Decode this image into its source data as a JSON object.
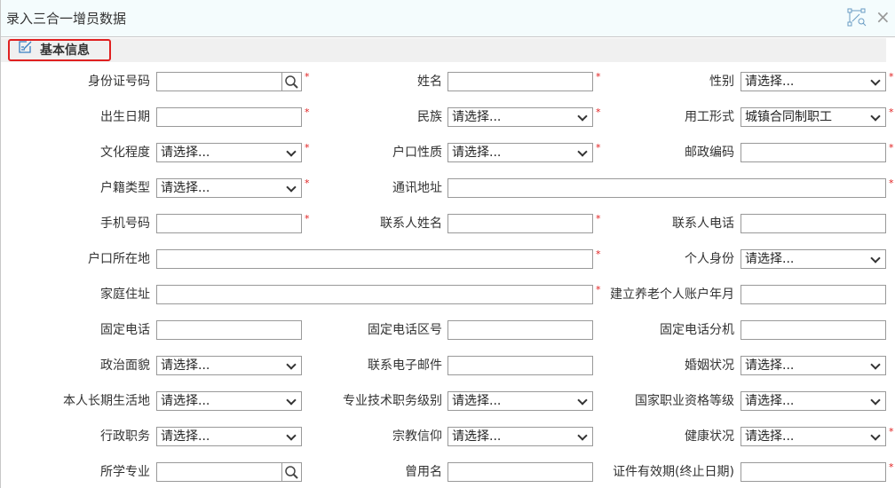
{
  "window": {
    "title": "录入三合一增员数据",
    "close": "×"
  },
  "section": {
    "title": "基本信息"
  },
  "rows": [
    [
      {
        "label": "身份证号码",
        "type": "search",
        "value": "",
        "req": true
      },
      {
        "label": "姓名",
        "type": "text",
        "value": "",
        "req": true
      },
      {
        "label": "性别",
        "type": "select",
        "value": "请选择...",
        "req": true
      }
    ],
    [
      {
        "label": "出生日期",
        "type": "text",
        "value": "",
        "req": true
      },
      {
        "label": "民族",
        "type": "select",
        "value": "请选择...",
        "req": true
      },
      {
        "label": "用工形式",
        "type": "select",
        "value": "城镇合同制职工",
        "req": true
      }
    ],
    [
      {
        "label": "文化程度",
        "type": "select",
        "value": "请选择...",
        "req": true
      },
      {
        "label": "户口性质",
        "type": "select",
        "value": "请选择...",
        "req": true
      },
      {
        "label": "邮政编码",
        "type": "text",
        "value": "",
        "req": true
      }
    ],
    [
      {
        "label": "户籍类型",
        "type": "select",
        "value": "请选择...",
        "req": true
      },
      {
        "label": "通讯地址",
        "type": "text",
        "value": "",
        "req": true,
        "span": 2
      }
    ],
    [
      {
        "label": "手机号码",
        "type": "text",
        "value": "",
        "req": true
      },
      {
        "label": "联系人姓名",
        "type": "text",
        "value": "",
        "req": true
      },
      {
        "label": "联系人电话",
        "type": "text",
        "value": "",
        "req": false
      }
    ],
    [
      {
        "label": "户口所在地",
        "type": "text",
        "value": "",
        "req": true,
        "span": 2
      },
      {
        "label": "个人身份",
        "type": "select",
        "value": "请选择...",
        "req": false
      }
    ],
    [
      {
        "label": "家庭住址",
        "type": "text",
        "value": "",
        "req": true,
        "span": 2
      },
      {
        "label": "建立养老个人账户年月",
        "type": "text",
        "value": "",
        "req": false
      }
    ],
    [
      {
        "label": "固定电话",
        "type": "text",
        "value": "",
        "req": false
      },
      {
        "label": "固定电话区号",
        "type": "text",
        "value": "",
        "req": false
      },
      {
        "label": "固定电话分机",
        "type": "text",
        "value": "",
        "req": false
      }
    ],
    [
      {
        "label": "政治面貌",
        "type": "select",
        "value": "请选择...",
        "req": false
      },
      {
        "label": "联系电子邮件",
        "type": "text",
        "value": "",
        "req": false
      },
      {
        "label": "婚姻状况",
        "type": "select",
        "value": "请选择...",
        "req": false
      }
    ],
    [
      {
        "label": "本人长期生活地",
        "type": "select",
        "value": "请选择...",
        "req": false
      },
      {
        "label": "专业技术职务级别",
        "type": "select",
        "value": "请选择...",
        "req": false
      },
      {
        "label": "国家职业资格等级",
        "type": "select",
        "value": "请选择...",
        "req": false
      }
    ],
    [
      {
        "label": "行政职务",
        "type": "select",
        "value": "请选择...",
        "req": false
      },
      {
        "label": "宗教信仰",
        "type": "select",
        "value": "请选择...",
        "req": false
      },
      {
        "label": "健康状况",
        "type": "select",
        "value": "请选择...",
        "req": true
      }
    ],
    [
      {
        "label": "所学专业",
        "type": "search",
        "value": "",
        "req": false
      },
      {
        "label": "曾用名",
        "type": "text",
        "value": "",
        "req": false
      },
      {
        "label": "证件有效期(终止日期)",
        "type": "text",
        "value": "",
        "req": true
      }
    ]
  ],
  "required_mark": "*",
  "colors": {
    "required": "#e02020",
    "header_bg": "#f4fcfd",
    "section_highlight": "#e02020"
  }
}
